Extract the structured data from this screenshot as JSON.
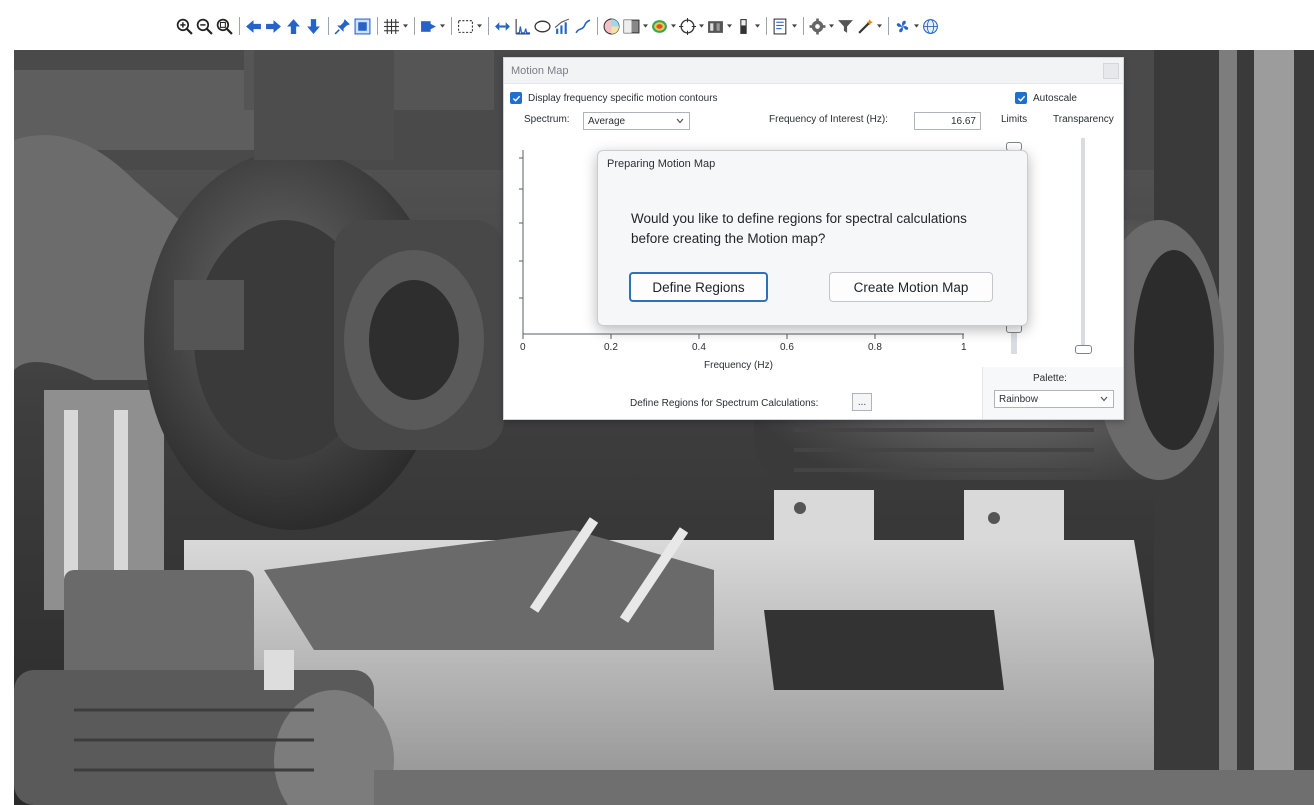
{
  "toolbar": {
    "icons": [
      "zoom-in-icon",
      "zoom-out-icon",
      "zoom-fit-icon",
      "arrow-left-icon",
      "arrow-right-icon",
      "arrow-up-icon",
      "arrow-down-icon",
      "pin-icon",
      "roi-icon",
      "grid-icon",
      "export-icon",
      "select-rect-icon",
      "range-icon",
      "spectrum-icon",
      "ellipse-icon",
      "trend-icon",
      "probe-icon",
      "color-wheel-icon",
      "gradient-icon",
      "heatmap-icon",
      "target-icon",
      "histogram-icon",
      "colorbar-icon",
      "report-icon",
      "settings-icon",
      "filter-icon",
      "magic-wand-icon",
      "fan-icon",
      "globe-icon"
    ]
  },
  "motion_map": {
    "title": "Motion Map",
    "display_contours_label": "Display frequency specific motion contours",
    "autoscale_label": "Autoscale",
    "spectrum_label": "Spectrum:",
    "spectrum_value": "Average",
    "frequency_label": "Frequency of Interest (Hz):",
    "frequency_value": "16.67",
    "limits_label": "Limits",
    "transparency_label": "Transparency",
    "x_ticks": [
      "0",
      "0.2",
      "0.4",
      "0.6",
      "0.8",
      "1"
    ],
    "xlabel": "Frequency (Hz)",
    "palette_label": "Palette:",
    "palette_value": "Rainbow",
    "define_regions_label": "Define Regions for Spectrum Calculations:",
    "define_regions_button": "..."
  },
  "dialog": {
    "title": "Preparing Motion Map",
    "message_line1": "Would you like to define regions for spectral calculations",
    "message_line2": "before creating the Motion map?",
    "define_regions_button": "Define Regions",
    "create_button": "Create Motion Map"
  },
  "colors": {
    "checkbox": "#1f6fd1",
    "primary_border": "#2f6fc0",
    "toolbar_blue": "#2563c9"
  }
}
